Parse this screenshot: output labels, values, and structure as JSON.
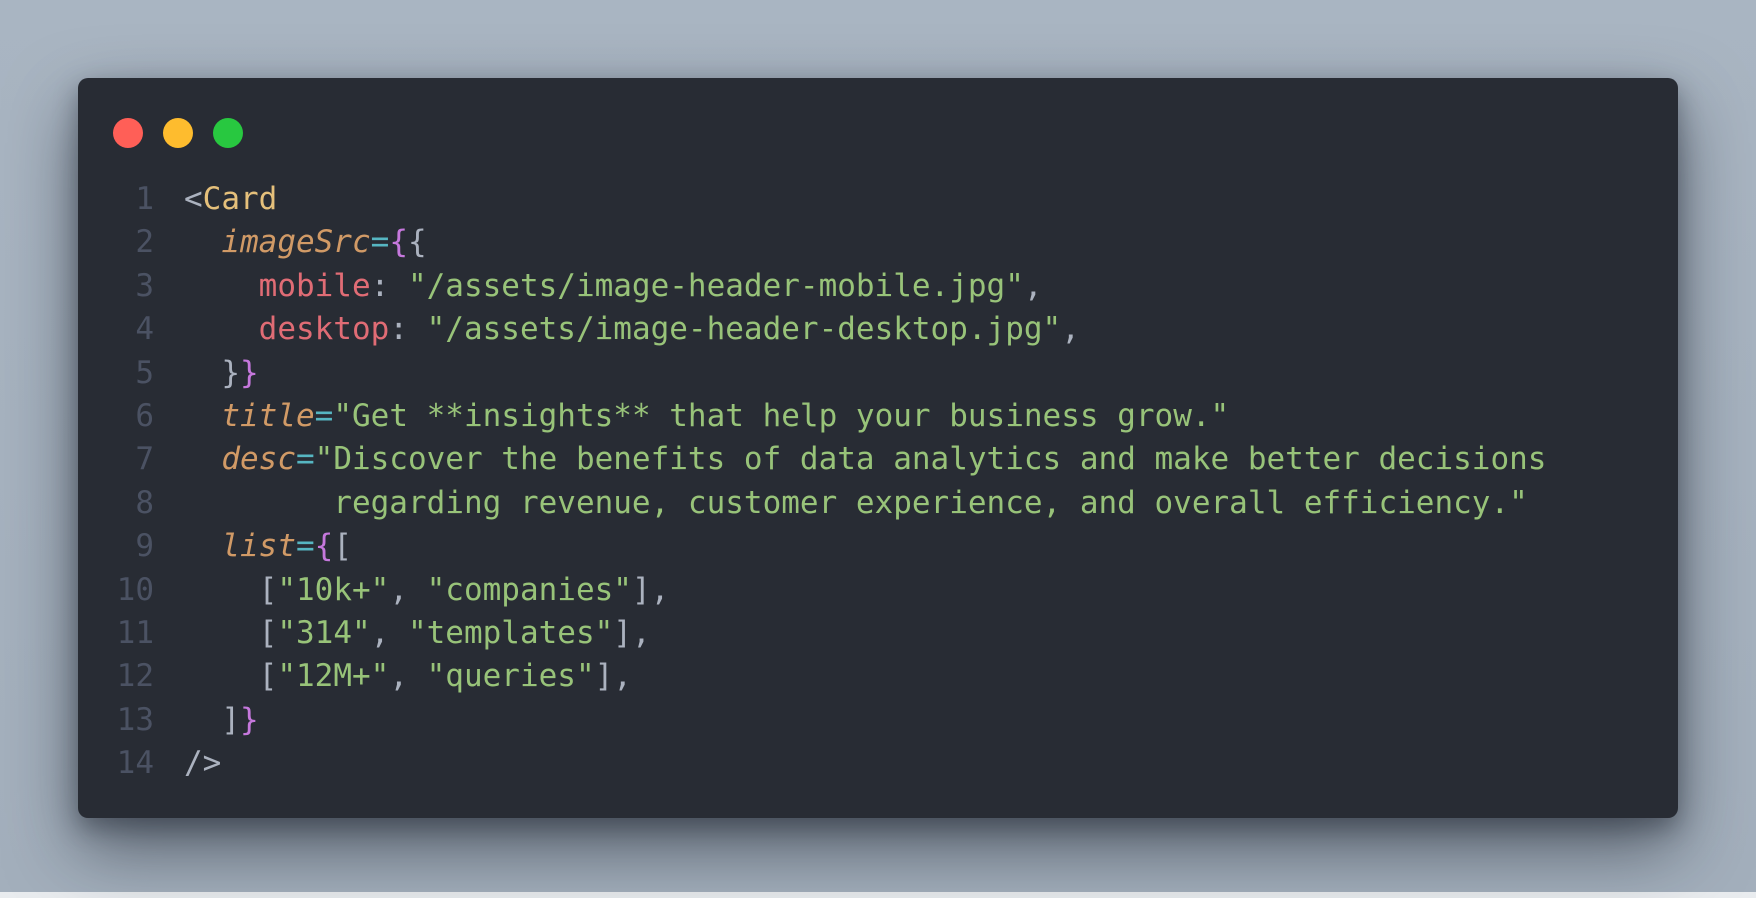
{
  "window": {
    "controls": [
      {
        "name": "close",
        "color": "#ff5f57"
      },
      {
        "name": "minimize",
        "color": "#febc2e"
      },
      {
        "name": "maximize",
        "color": "#28c840"
      }
    ]
  },
  "code": {
    "language": "jsx",
    "lines": [
      {
        "number": "1",
        "indent": "",
        "tokens": [
          {
            "t": "<",
            "c": "punc"
          },
          {
            "t": "Card",
            "c": "tag"
          }
        ]
      },
      {
        "number": "2",
        "indent": "  ",
        "tokens": [
          {
            "t": "imageSrc",
            "c": "attr"
          },
          {
            "t": "=",
            "c": "eq"
          },
          {
            "t": "{",
            "c": "brace"
          },
          {
            "t": "{",
            "c": "punc"
          }
        ]
      },
      {
        "number": "3",
        "indent": "    ",
        "tokens": [
          {
            "t": "mobile",
            "c": "key"
          },
          {
            "t": ": ",
            "c": "punc"
          },
          {
            "t": "\"/assets/image-header-mobile.jpg\"",
            "c": "str"
          },
          {
            "t": ",",
            "c": "punc"
          }
        ]
      },
      {
        "number": "4",
        "indent": "    ",
        "tokens": [
          {
            "t": "desktop",
            "c": "key"
          },
          {
            "t": ": ",
            "c": "punc"
          },
          {
            "t": "\"/assets/image-header-desktop.jpg\"",
            "c": "str"
          },
          {
            "t": ",",
            "c": "punc"
          }
        ]
      },
      {
        "number": "5",
        "indent": "  ",
        "tokens": [
          {
            "t": "}",
            "c": "punc"
          },
          {
            "t": "}",
            "c": "brace"
          }
        ]
      },
      {
        "number": "6",
        "indent": "  ",
        "tokens": [
          {
            "t": "title",
            "c": "attr"
          },
          {
            "t": "=",
            "c": "eq"
          },
          {
            "t": "\"Get **insights** that help your business grow.\"",
            "c": "str"
          }
        ]
      },
      {
        "number": "7",
        "indent": "  ",
        "tokens": [
          {
            "t": "desc",
            "c": "attr"
          },
          {
            "t": "=",
            "c": "eq"
          },
          {
            "t": "\"Discover the benefits of data analytics and make better decisions",
            "c": "str"
          }
        ]
      },
      {
        "number": "8",
        "indent": "        ",
        "tokens": [
          {
            "t": "regarding revenue, customer experience, and overall efficiency.\"",
            "c": "str"
          }
        ]
      },
      {
        "number": "9",
        "indent": "  ",
        "tokens": [
          {
            "t": "list",
            "c": "attr"
          },
          {
            "t": "=",
            "c": "eq"
          },
          {
            "t": "{",
            "c": "brace"
          },
          {
            "t": "[",
            "c": "punc"
          }
        ]
      },
      {
        "number": "10",
        "indent": "    ",
        "tokens": [
          {
            "t": "[",
            "c": "punc"
          },
          {
            "t": "\"10k+\"",
            "c": "str"
          },
          {
            "t": ", ",
            "c": "punc"
          },
          {
            "t": "\"companies\"",
            "c": "str"
          },
          {
            "t": "],",
            "c": "punc"
          }
        ]
      },
      {
        "number": "11",
        "indent": "    ",
        "tokens": [
          {
            "t": "[",
            "c": "punc"
          },
          {
            "t": "\"314\"",
            "c": "str"
          },
          {
            "t": ", ",
            "c": "punc"
          },
          {
            "t": "\"templates\"",
            "c": "str"
          },
          {
            "t": "],",
            "c": "punc"
          }
        ]
      },
      {
        "number": "12",
        "indent": "    ",
        "tokens": [
          {
            "t": "[",
            "c": "punc"
          },
          {
            "t": "\"12M+\"",
            "c": "str"
          },
          {
            "t": ", ",
            "c": "punc"
          },
          {
            "t": "\"queries\"",
            "c": "str"
          },
          {
            "t": "],",
            "c": "punc"
          }
        ]
      },
      {
        "number": "13",
        "indent": "  ",
        "tokens": [
          {
            "t": "]",
            "c": "punc"
          },
          {
            "t": "}",
            "c": "brace"
          }
        ]
      },
      {
        "number": "14",
        "indent": "",
        "tokens": [
          {
            "t": "/>",
            "c": "punc"
          }
        ]
      }
    ]
  }
}
